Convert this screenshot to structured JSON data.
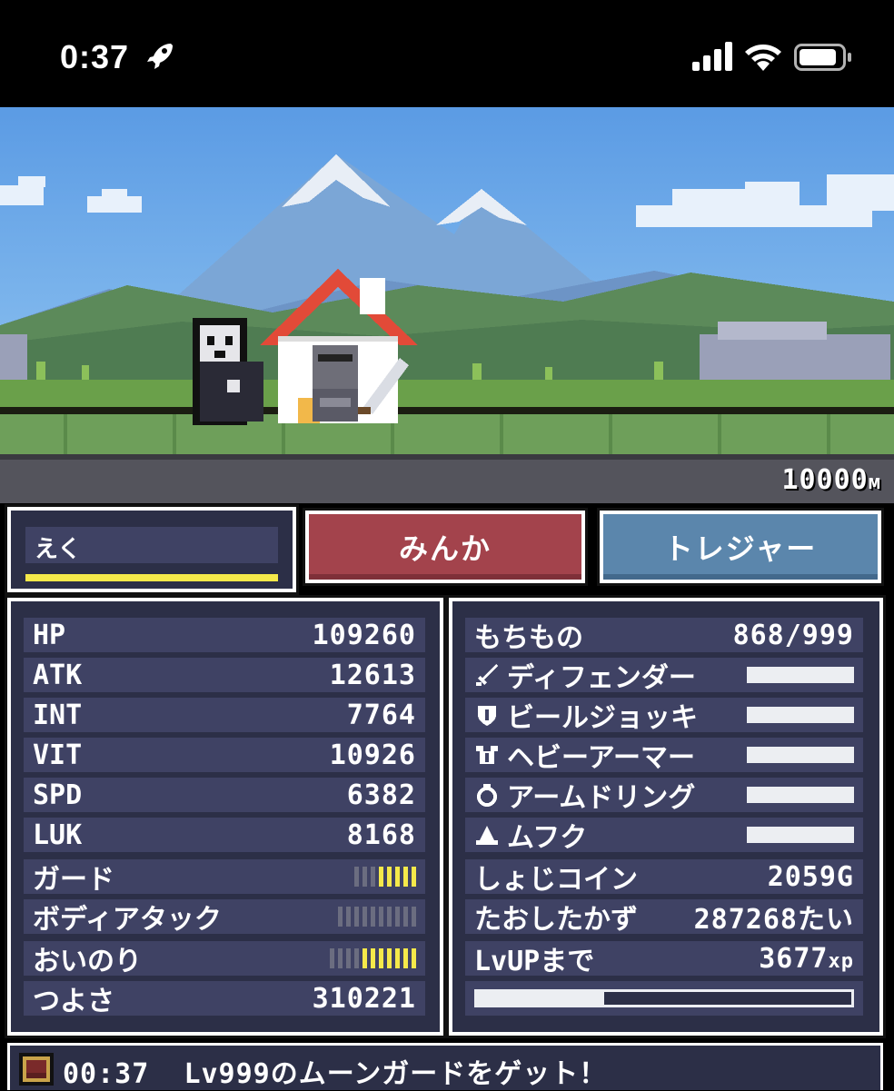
{
  "status_bar": {
    "time": "0:37"
  },
  "scene": {
    "distance": "10000",
    "distance_unit": "м"
  },
  "player": {
    "name": "えく",
    "name_bar_fill": 1.0
  },
  "buttons": {
    "minka": "みんか",
    "treasure": "トレジャー"
  },
  "stats": [
    {
      "label": "HP",
      "value": "109260"
    },
    {
      "label": "ATK",
      "value": "12613"
    },
    {
      "label": "INT",
      "value": "7764"
    },
    {
      "label": "VIT",
      "value": "10926"
    },
    {
      "label": "SPD",
      "value": "6382"
    },
    {
      "label": "LUK",
      "value": "8168"
    }
  ],
  "skills": [
    {
      "label": "ガード",
      "level": 5,
      "max": 8
    },
    {
      "label": "ボディアタック",
      "level": 0,
      "max": 10
    },
    {
      "label": "おいのり",
      "level": 7,
      "max": 11
    }
  ],
  "power": {
    "label": "つよさ",
    "value": "310221"
  },
  "inventory": {
    "label": "もちもの",
    "value": "868/999",
    "equipment": [
      {
        "icon": "sword-icon",
        "label": "ディフェンダー"
      },
      {
        "icon": "shield-icon",
        "label": "ビールジョッキ"
      },
      {
        "icon": "armor-icon",
        "label": "ヘビーアーマー"
      },
      {
        "icon": "ring-icon",
        "label": "アームドリング"
      },
      {
        "icon": "hat-icon",
        "label": "ムフク"
      }
    ]
  },
  "coins": {
    "label": "しょじコイン",
    "value": "2059G"
  },
  "defeated": {
    "label": "たおしたかず",
    "value": "287268たい"
  },
  "lvup": {
    "label": "LvUPまで",
    "value": "3677",
    "unit": "xp"
  },
  "xp_progress": 0.34,
  "message": {
    "time": "00:37",
    "text": "Lv999のムーンガードをゲット！"
  },
  "colors": {
    "panel": "#2c2f47",
    "row": "#3f4264",
    "accent_yellow": "#f5e94a",
    "minka_button": "#a3434c",
    "treasure_button": "#5b86ac"
  }
}
